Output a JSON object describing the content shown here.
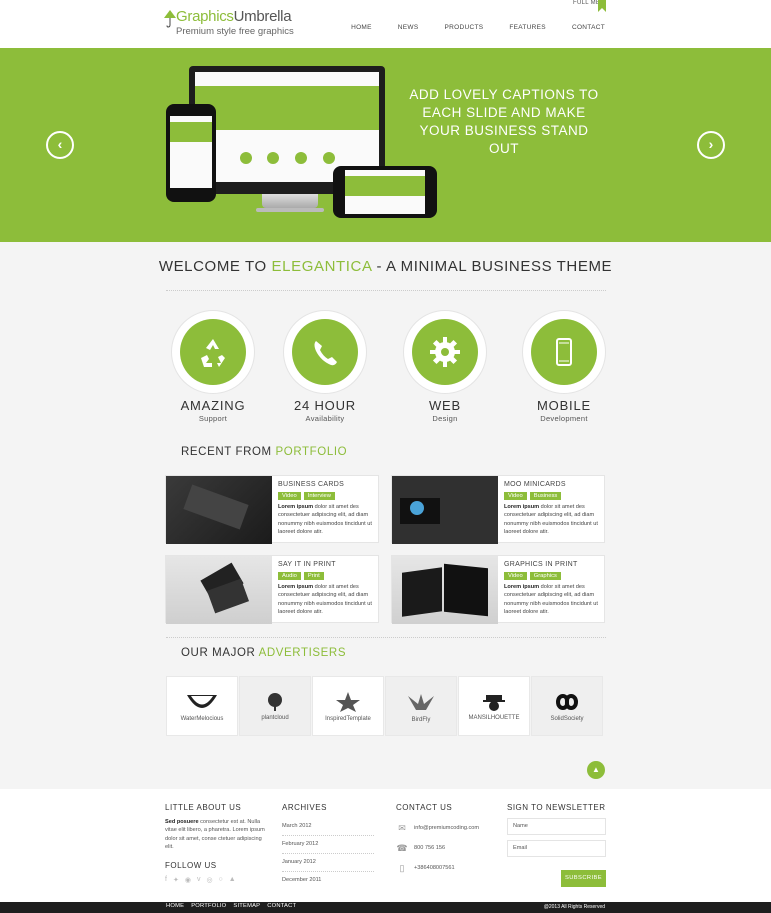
{
  "header": {
    "logo_part1": "Graphics",
    "logo_part2": "Umbrella",
    "tagline": "Premium style free graphics",
    "full_me": "FULL ME",
    "nav": [
      "HOME",
      "NEWS",
      "PRODUCTS",
      "FEATURES",
      "CONTACT"
    ]
  },
  "slider": {
    "caption": "ADD LOVELY CAPTIONS TO EACH SLIDE AND MAKE YOUR BUSINESS STAND OUT",
    "prev_icon": "chevron-left-icon",
    "next_icon": "chevron-right-icon"
  },
  "welcome": {
    "prefix": "WELCOME TO ",
    "brand": "ELEGANTICA",
    "suffix": " - A MINIMAL BUSINESS THEME"
  },
  "features": [
    {
      "title": "AMAZING",
      "sub": "Support",
      "icon": "recycle-icon"
    },
    {
      "title": "24 HOUR",
      "sub": "Availability",
      "icon": "phone-icon"
    },
    {
      "title": "WEB",
      "sub": "Design",
      "icon": "gear-icon"
    },
    {
      "title": "MOBILE",
      "sub": "Development",
      "icon": "mobile-icon"
    }
  ],
  "portfolio": {
    "title_a": "RECENT FROM ",
    "title_b": "PORTFOLIO",
    "lorem_bold": "Lorem ipsum",
    "lorem_rest": " dolor sit amet des consectetuer adipiscing elit, ad diam nonummy nibh euismodos tincidunt ut laoreet dolore atir.",
    "items": [
      {
        "title": "BUSINESS CARDS",
        "tags": [
          "Video",
          "Interview"
        ]
      },
      {
        "title": "MOO MINICARDS",
        "tags": [
          "Video",
          "Business"
        ]
      },
      {
        "title": "SAY IT IN PRINT",
        "tags": [
          "Audio",
          "Print"
        ]
      },
      {
        "title": "GRAPHICS IN PRINT",
        "tags": [
          "Video",
          "Graphics"
        ]
      }
    ]
  },
  "advertisers": {
    "title_a": "OUR MAJOR ",
    "title_b": "ADVERTISERS",
    "items": [
      "WaterMelocious",
      "plantcloud",
      "InspiredTemplate",
      "BirdFly",
      "MANSILHOUETTE",
      "SolidSociety"
    ]
  },
  "footer": {
    "about_title": "LITTLE ABOUT US",
    "about_bold": "Sed posuere",
    "about_rest": " consectetur est at. Nulla vitae elit libero, a pharetra. Lorem ipsum dolor sit amet, conse ctetuer adipiscing elit.",
    "follow_title": "FOLLOW US",
    "archives_title": "ARCHIVES",
    "archives": [
      "March 2012",
      "February 2012",
      "January 2012",
      "December 2011"
    ],
    "contact_title": "CONTACT US",
    "email": "info@premiumcoding.com",
    "phone": "800 756 156",
    "mobile": "+386408007561",
    "newsletter_title": "SIGN TO NEWSLETTER",
    "name_placeholder": "Name",
    "email_placeholder": "Email",
    "subscribe": "SUBSCRIBE"
  },
  "bottom": {
    "nav": [
      "HOME",
      "PORTFOLIO",
      "SITEMAP",
      "CONTACT"
    ],
    "copyright": "@2013 All Rights Reserved"
  },
  "colors": {
    "accent": "#8dbd3a",
    "dark": "#1e1e1e"
  }
}
